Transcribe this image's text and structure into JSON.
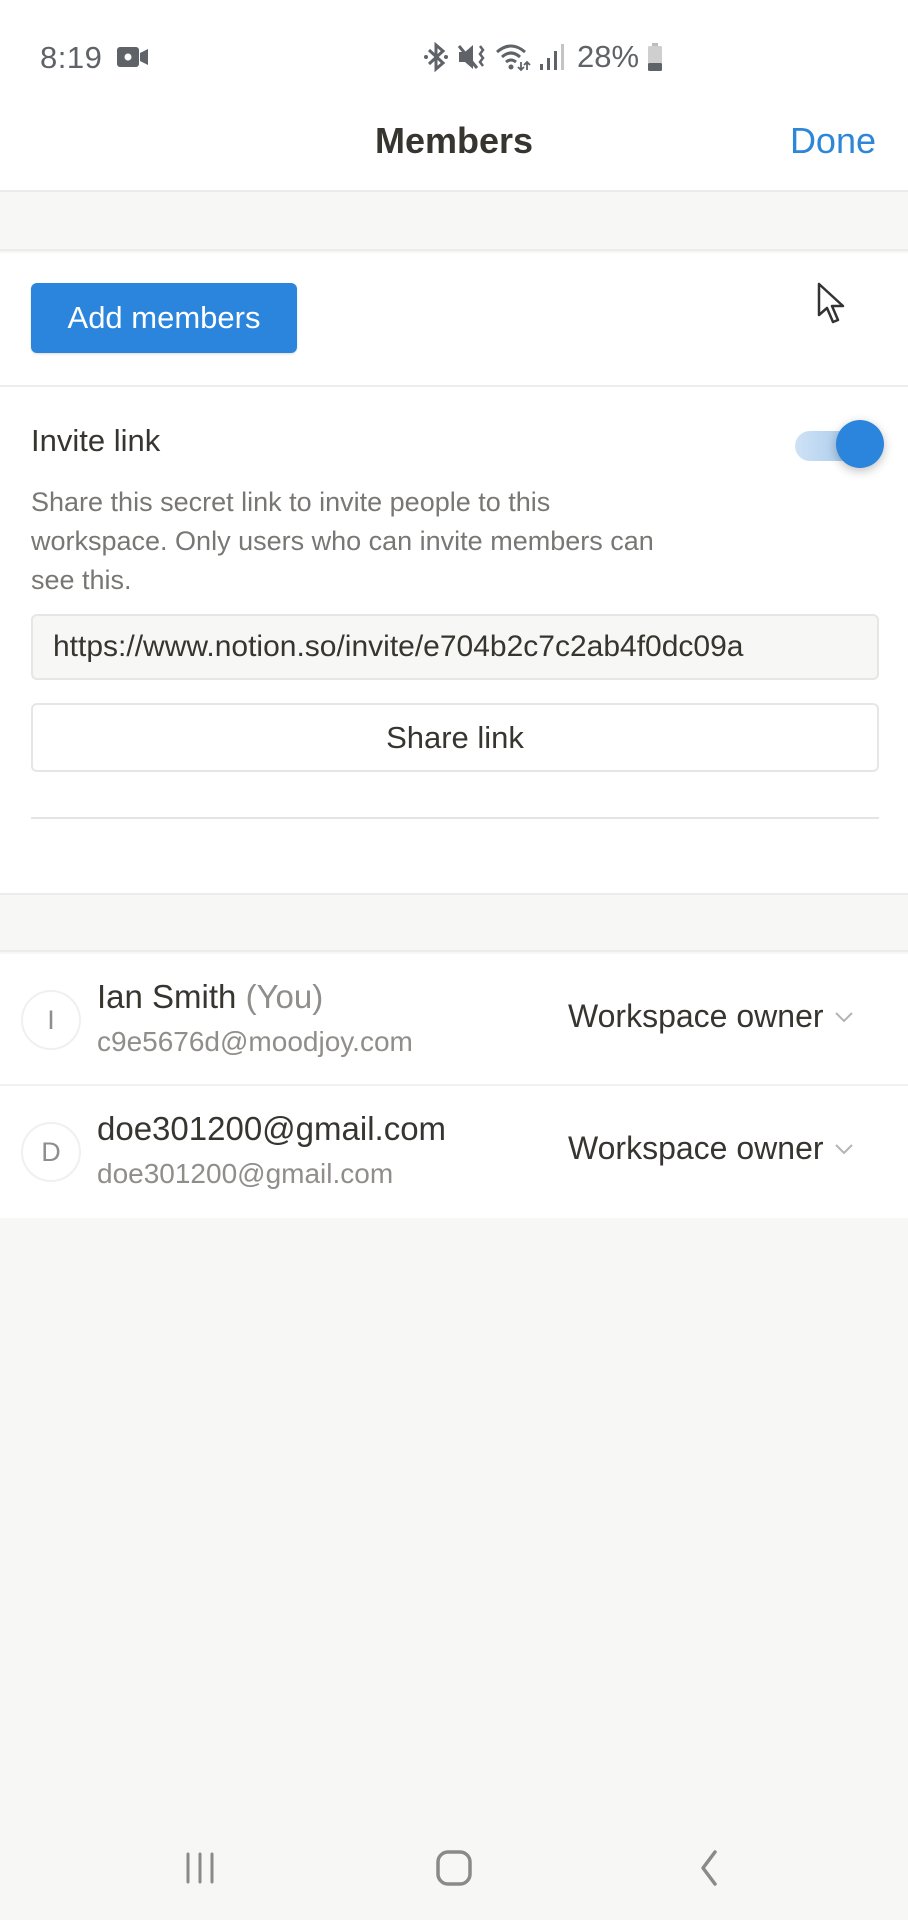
{
  "status_bar": {
    "time": "8:19",
    "battery_percent": "28%",
    "icons": [
      "video-camera-icon",
      "bluetooth-icon",
      "mute-vibrate-icon",
      "wifi-icon",
      "signal-icon",
      "battery-icon"
    ]
  },
  "header": {
    "title": "Members",
    "done_label": "Done"
  },
  "invite": {
    "add_members_label": "Add members",
    "invite_link_label": "Invite link",
    "invite_link_enabled": true,
    "description": "Share this secret link to invite people to this workspace. Only users who can invite members can see this.",
    "link_value": "https://www.notion.so/invite/e704b2c7c2ab4f0dc09a",
    "share_link_label": "Share link"
  },
  "members": [
    {
      "initial": "I",
      "name": "Ian Smith",
      "you_tag": "(You)",
      "email": "c9e5676d@moodjoy.com",
      "role": "Workspace owner"
    },
    {
      "initial": "D",
      "name": "doe301200@gmail.com",
      "you_tag": "",
      "email": "doe301200@gmail.com",
      "role": "Workspace owner"
    }
  ],
  "colors": {
    "accent": "#2b85dc",
    "done_text": "#2e86d8",
    "text_primary": "#37352f",
    "text_secondary": "#787774",
    "background": "#f7f8f5"
  },
  "nav": {
    "icons": [
      "recent-apps-icon",
      "home-icon",
      "back-icon"
    ]
  }
}
